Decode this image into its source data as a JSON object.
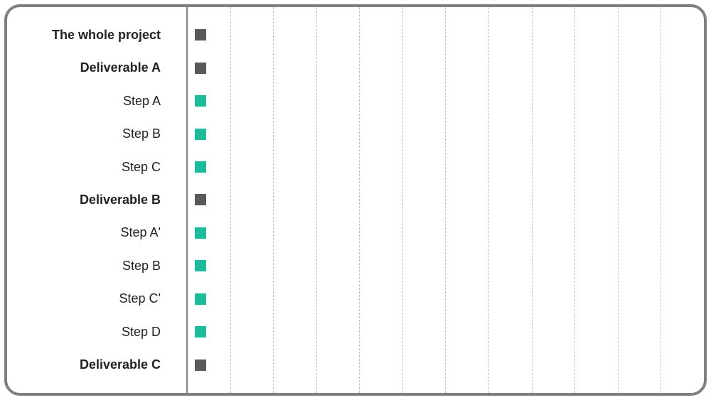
{
  "chart_data": {
    "type": "bar",
    "title": "",
    "xlabel": "",
    "ylabel": "",
    "columns": 12,
    "series": [
      {
        "name": "The whole project",
        "level": "group",
        "values": [
          1
        ]
      },
      {
        "name": "Deliverable A",
        "level": "group",
        "values": [
          1
        ]
      },
      {
        "name": "Step A",
        "level": "step",
        "values": [
          1
        ]
      },
      {
        "name": "Step B",
        "level": "step",
        "values": [
          1
        ]
      },
      {
        "name": "Step C",
        "level": "step",
        "values": [
          1
        ]
      },
      {
        "name": "Deliverable B",
        "level": "group",
        "values": [
          1
        ]
      },
      {
        "name": "Step A'",
        "level": "step",
        "values": [
          1
        ]
      },
      {
        "name": "Step B",
        "level": "step",
        "values": [
          1
        ]
      },
      {
        "name": "Step C'",
        "level": "step",
        "values": [
          1
        ]
      },
      {
        "name": "Step D",
        "level": "step",
        "values": [
          1
        ]
      },
      {
        "name": "Deliverable C",
        "level": "group",
        "values": [
          1
        ]
      }
    ]
  },
  "colors": {
    "group_marker": "#595959",
    "step_marker": "#1abc9c",
    "frame": "#7f7f7f",
    "grid": "#bfbfbf"
  }
}
